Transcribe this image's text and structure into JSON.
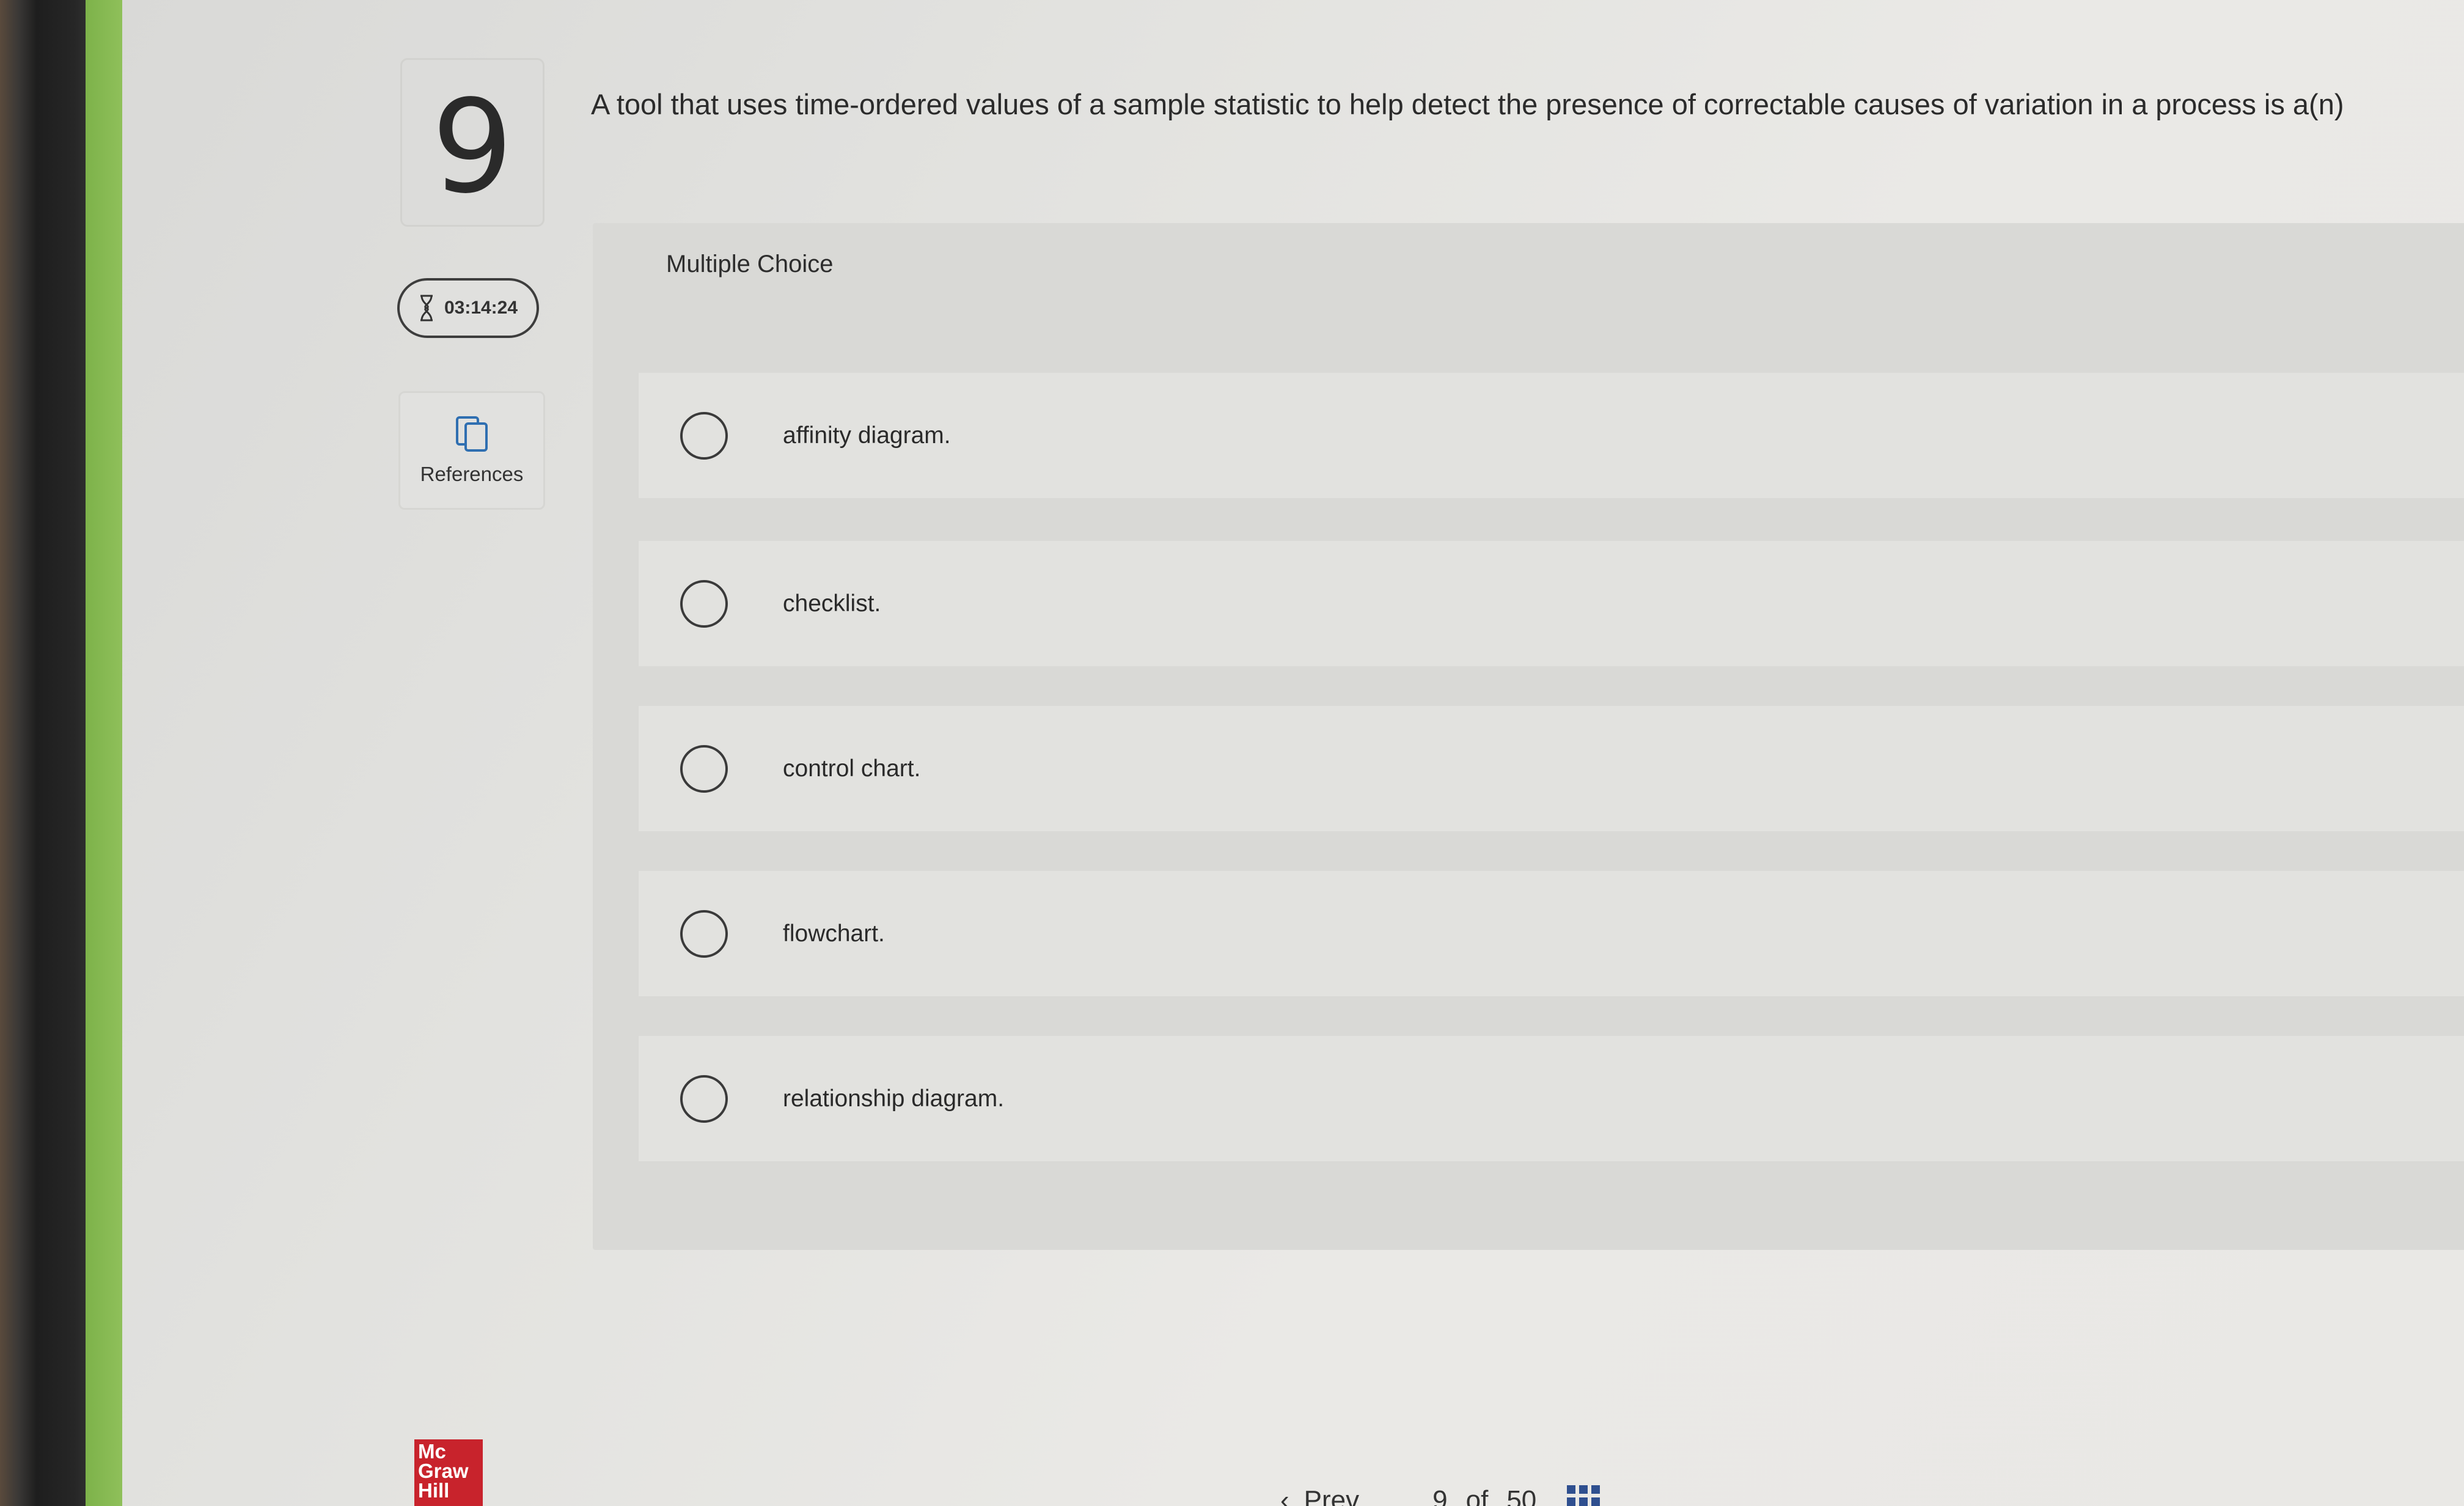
{
  "question": {
    "number": "9",
    "text": "A tool that uses time-ordered values of a sample statistic to help detect the presence of correctable causes of variation in a process is a(n)"
  },
  "timer": {
    "icon": "hourglass-icon",
    "value": "03:14:24"
  },
  "references": {
    "icon": "copy-icon",
    "label": "References"
  },
  "multiple_choice": {
    "title": "Multiple Choice",
    "options": [
      "affinity diagram.",
      "checklist.",
      "control chart.",
      "flowchart.",
      "relationship diagram."
    ]
  },
  "footer": {
    "logo": {
      "line1": "Mc",
      "line2": "Graw",
      "line3": "Hill"
    },
    "prev_label": "Prev",
    "page_current": "9",
    "page_of": "of",
    "page_total": "50"
  },
  "colors": {
    "accent_green": "#8fc05a",
    "logo_red": "#c8232c"
  }
}
